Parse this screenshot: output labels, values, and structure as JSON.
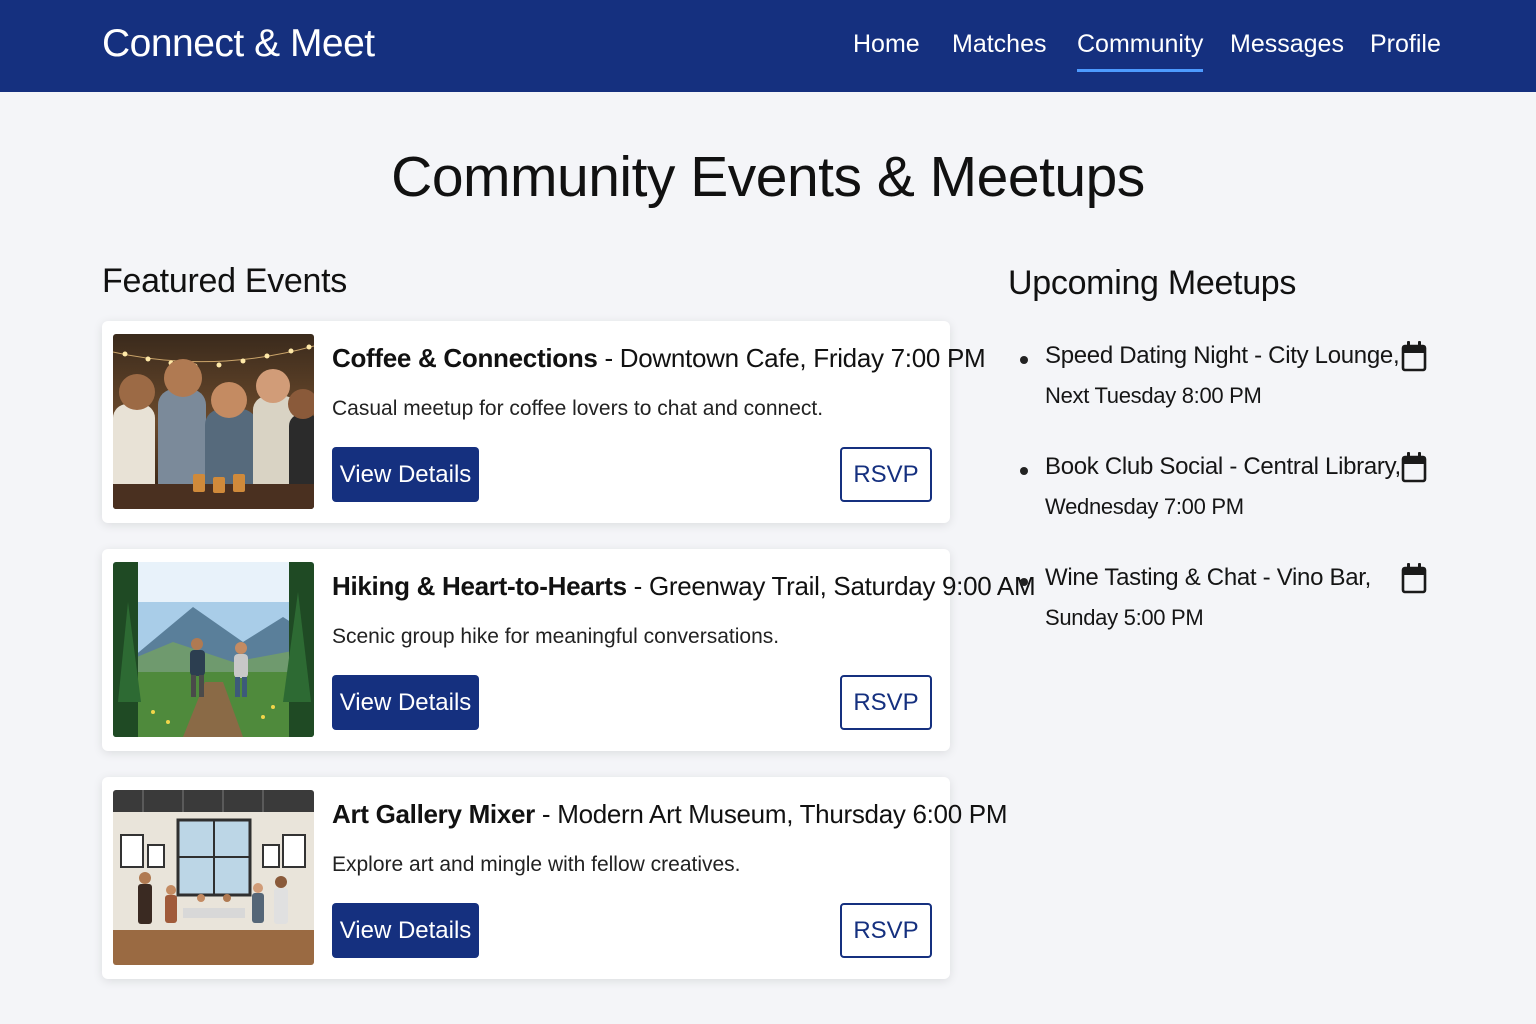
{
  "header": {
    "brand": "Connect & Meet",
    "nav": [
      {
        "label": "Home",
        "active": false
      },
      {
        "label": "Matches",
        "active": false
      },
      {
        "label": "Community",
        "active": true
      },
      {
        "label": "Messages",
        "active": false
      },
      {
        "label": "Profile",
        "active": false
      }
    ]
  },
  "page_title": "Community Events & Meetups",
  "featured": {
    "heading": "Featured Events",
    "events": [
      {
        "name": "Coffee & Connections",
        "details": " - Downtown Cafe, Friday 7:00 PM",
        "description": "Casual meetup for coffee lovers to chat and connect.",
        "photo_icon": "cafe-group-photo",
        "details_label": "View Details",
        "rsvp_label": "RSVP"
      },
      {
        "name": "Hiking & Heart-to-Hearts",
        "details": " - Greenway Trail, Saturday 9:00 AM",
        "description": "Scenic group hike for meaningful conversations.",
        "photo_icon": "hiking-trail-photo",
        "details_label": "View Details",
        "rsvp_label": "RSVP"
      },
      {
        "name": "Art Gallery Mixer",
        "details": " - Modern Art Museum, Thursday 6:00 PM",
        "description": "Explore art and mingle with fellow creatives.",
        "photo_icon": "art-gallery-photo",
        "details_label": "View Details",
        "rsvp_label": "RSVP"
      }
    ]
  },
  "upcoming": {
    "heading": "Upcoming Meetups",
    "items": [
      {
        "line1": "Speed Dating Night - City Lounge,",
        "line2": "Next Tuesday 8:00 PM",
        "icon": "calendar-icon"
      },
      {
        "line1": "Book Club Social - Central Library,",
        "line2": "Wednesday 7:00 PM",
        "icon": "calendar-icon"
      },
      {
        "line1": "Wine Tasting & Chat - Vino Bar,",
        "line2": "Sunday 5:00 PM",
        "icon": "calendar-icon"
      }
    ]
  },
  "colors": {
    "header_bg": "#15307f",
    "active_underline": "#4d9bff",
    "page_bg": "#f4f5f8",
    "button_primary": "#15307f"
  }
}
